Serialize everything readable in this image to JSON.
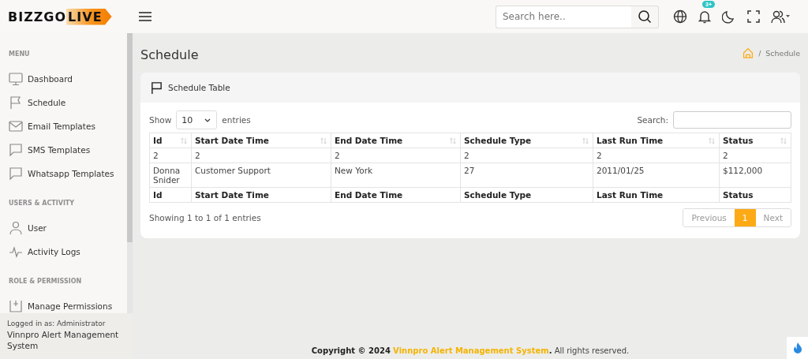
{
  "header": {
    "logo": {
      "main": "BIZZGO",
      "accent": "LIVE"
    },
    "search": {
      "placeholder": "Search here.."
    },
    "notifications": {
      "badge": "3+"
    }
  },
  "sidebar": {
    "sections": [
      {
        "title": "MENU",
        "items": [
          {
            "label": "Dashboard"
          },
          {
            "label": "Schedule"
          },
          {
            "label": "Email Templates"
          },
          {
            "label": "SMS Templates"
          },
          {
            "label": "Whatsapp Templates"
          }
        ]
      },
      {
        "title": "USERS & ACTIVITY",
        "items": [
          {
            "label": "User"
          },
          {
            "label": "Activity Logs"
          }
        ]
      },
      {
        "title": "ROLE & PERMISSION",
        "items": [
          {
            "label": "Manage Permissions"
          }
        ]
      }
    ],
    "footer": {
      "logged_in": "Logged in as: Administrator",
      "system": "Vinnpro Alert Management System"
    }
  },
  "page": {
    "title": "Schedule",
    "breadcrumb": {
      "separator": "/",
      "items": [
        "Schedule"
      ]
    }
  },
  "card": {
    "title": "Schedule Table",
    "length": {
      "label_before": "Show",
      "value": "10",
      "label_after": "entries"
    },
    "search": {
      "label": "Search:"
    },
    "table": {
      "columns": [
        {
          "label": "Id"
        },
        {
          "label": "Start Date Time"
        },
        {
          "label": "End Date Time"
        },
        {
          "label": "Schedule Type"
        },
        {
          "label": "Last Run Time"
        },
        {
          "label": "Status"
        }
      ],
      "rows": [
        [
          "2",
          "2",
          "2",
          "2",
          "2",
          "2"
        ],
        [
          "Donna Snider",
          "Customer Support",
          "New York",
          "27",
          "2011/01/25",
          "$112,000"
        ]
      ],
      "footer": [
        "Id",
        "Start Date Time",
        "End Date Time",
        "Schedule Type",
        "Last Run Time",
        "Status"
      ]
    },
    "info": "Showing 1 to 1 of 1 entries",
    "pagination": {
      "previous": "Previous",
      "pages": [
        {
          "label": "1",
          "selected": true
        }
      ],
      "next": "Next"
    }
  },
  "footer": {
    "before": "**Copyright © 2024**",
    "link": "Vinnpro Alert Management System",
    "after": "**.** All rights reserved."
  }
}
